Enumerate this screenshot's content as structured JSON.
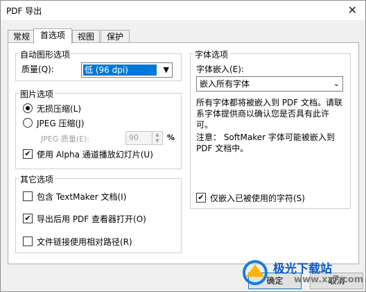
{
  "window": {
    "title": "PDF 导出",
    "close_glyph": "✕"
  },
  "tabs": [
    {
      "label": "常规",
      "active": false
    },
    {
      "label": "首选项",
      "active": true
    },
    {
      "label": "视图",
      "active": false
    },
    {
      "label": "保护",
      "active": false
    }
  ],
  "auto_graphics": {
    "title": "自动图形选项",
    "quality_label": "质量(Q):",
    "quality_value": "低 (96 dpi)"
  },
  "image_options": {
    "title": "图片选项",
    "lossless_label": "无损压缩(L)",
    "lossless_checked": true,
    "jpeg_label": "JPEG 压缩(J)",
    "jpeg_checked": false,
    "jpeg_quality_label": "JPEG 质量(E):",
    "jpeg_quality_value": "90",
    "jpeg_quality_unit": "%",
    "alpha_label": "使用 Alpha 通道播放幻灯片(U)",
    "alpha_checked": true
  },
  "other_options": {
    "title": "其它选项",
    "include_doc_label": "包含 TextMaker 文档(I)",
    "include_doc_checked": false,
    "open_viewer_label": "导出后用 PDF 查看器打开(O)",
    "open_viewer_checked": true,
    "relative_paths_label": "文件链接使用相对路径(R)",
    "relative_paths_checked": false
  },
  "font_options": {
    "title": "字体选项",
    "embed_label": "字体嵌入(E):",
    "embed_value": "嵌入所有字体",
    "info_text": "所有字体都将被嵌入到 PDF 文档。请联系字体提供商以确认您是否具有此许可。",
    "note_text": "注意： SoftMaker 字体可能被嵌入到 PDF 文档中。",
    "only_used_label": "仅嵌入已被使用的字符(S)",
    "only_used_checked": true
  },
  "buttons": {
    "ok": "确定",
    "cancel": "取消"
  },
  "watermark": {
    "brand": "极光下载站",
    "url": "www.xz7.com"
  }
}
